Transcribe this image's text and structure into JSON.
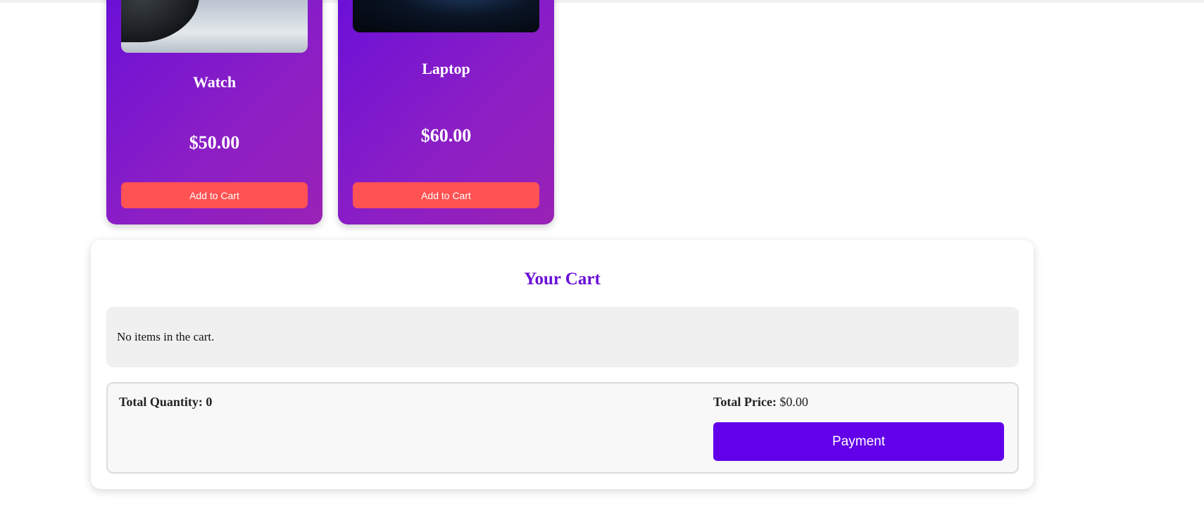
{
  "products": [
    {
      "name": "Watch",
      "price": "$50.00",
      "button_label": "Add to Cart",
      "image": "watch-photo"
    },
    {
      "name": "Laptop",
      "price": "$60.00",
      "button_label": "Add to Cart",
      "image": "laptop-photo"
    }
  ],
  "cart": {
    "title": "Your Cart",
    "empty_message": "No items in the cart.",
    "total_quantity_label": "Total Quantity:",
    "total_quantity_value": "0",
    "total_price_label": "Total Price:",
    "total_price_value": "$0.00",
    "payment_label": "Payment"
  },
  "colors": {
    "accent": "#6200ea",
    "title": "#6a0fd8",
    "add_to_cart": "#ff5252",
    "card_gradient_start": "#6a0fd8",
    "card_gradient_end": "#9a22b6"
  }
}
